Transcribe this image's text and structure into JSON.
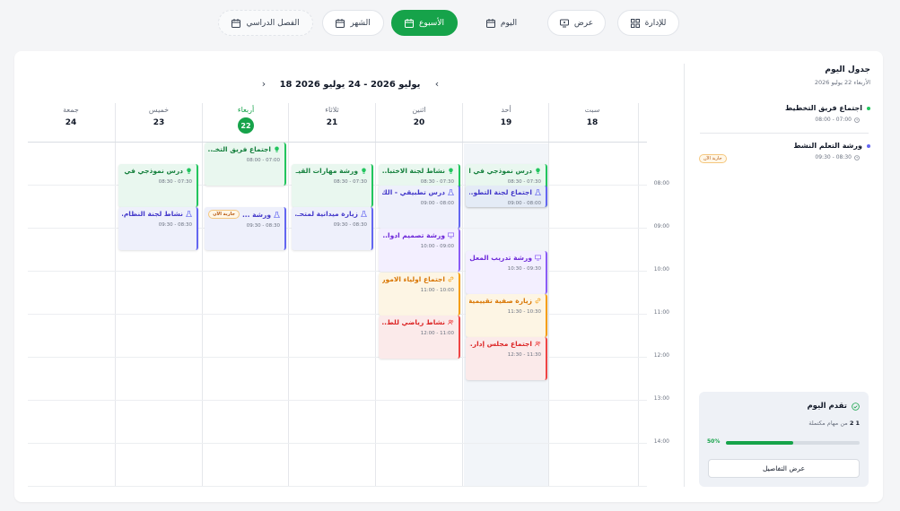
{
  "toolbar": {
    "admin": "للإدارة",
    "view": "عرض",
    "day": "اليوم",
    "week": "الأسبوع",
    "month": "الشهر",
    "semester": "الفصل الدراسي"
  },
  "calendar": {
    "range": "18 يوليو 2026 - 24 يوليو 2026",
    "days": [
      {
        "name": "سبت",
        "num": "18"
      },
      {
        "name": "أحد",
        "num": "19"
      },
      {
        "name": "اثنين",
        "num": "20"
      },
      {
        "name": "ثلاثاء",
        "num": "21"
      },
      {
        "name": "أربعاء",
        "num": "22"
      },
      {
        "name": "خميس",
        "num": "23"
      },
      {
        "name": "جمعة",
        "num": "24"
      }
    ],
    "times": [
      "08:00",
      "09:00",
      "10:00",
      "11:00",
      "12:00",
      "13:00",
      "14:00"
    ],
    "badge": "جارية الآن",
    "events": {
      "e1": {
        "title": "درس نموذجي في ا...",
        "time": "07:30 - 08:30"
      },
      "e2": {
        "title": "اجتماع لجنة التطو...",
        "time": "08:00 - 09:00"
      },
      "e3": {
        "title": "ورشة تدريب المعل...",
        "time": "09:30 - 10:30"
      },
      "e4": {
        "title": "زيارة صفية تقييمية",
        "time": "10:30 - 11:30"
      },
      "e5": {
        "title": "اجتماع مجلس إدار...",
        "time": "11:30 - 12:30"
      },
      "e6": {
        "title": "نشاط لجنة الاختبا...",
        "time": "07:30 - 08:30"
      },
      "e7": {
        "title": "درس تطبيقي - الك...",
        "time": "08:00 - 09:00"
      },
      "e8": {
        "title": "ورشة تصميم ادوا...",
        "time": "09:00 - 10:00"
      },
      "e9": {
        "title": "اجتماع اولياء الامور",
        "time": "10:00 - 11:00"
      },
      "e10": {
        "title": "نشاط رياضي للط...",
        "time": "11:00 - 12:00"
      },
      "e11": {
        "title": "ورشة مهارات القيـ...",
        "time": "07:30 - 08:30"
      },
      "e12": {
        "title": "زيارة ميدانية لمتحـ...",
        "time": "08:30 - 09:30"
      },
      "e13": {
        "title": "اجتماع فريق التخـ...",
        "time": "07:00 - 08:00"
      },
      "e14": {
        "title": "ورشة ...",
        "time": "08:30 - 09:30"
      },
      "e15": {
        "title": "درس نموذجي في ا...",
        "time": "07:30 - 08:30"
      },
      "e16": {
        "title": "نشاط لجنة النظام...",
        "time": "08:30 - 09:30"
      }
    }
  },
  "sidebar": {
    "title": "جدول اليوم",
    "date": "الأربعاء 22 يوليو 2026",
    "items": [
      {
        "name": "اجتماع فريق التخطيط",
        "time": "07:00 - 08:00",
        "color": "#22c55e"
      },
      {
        "name": "ورشة التعلم النشط",
        "time": "08:30 - 09:30",
        "color": "#6366f1"
      }
    ],
    "badge": "جارية الآن"
  },
  "progress": {
    "title": "تقدم اليوم",
    "done": "1",
    "total": "2",
    "suffix": "من مهام مكتملة",
    "percent_label": "50%",
    "fraction": 0.5,
    "button": "عرض التفاصيل"
  }
}
